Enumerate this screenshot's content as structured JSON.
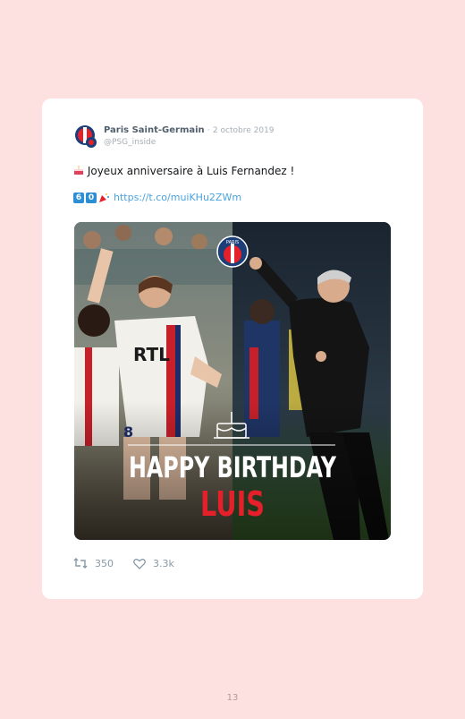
{
  "tweet": {
    "display_name": "Paris Saint-Germain",
    "separator": "·",
    "date": "2 octobre 2019",
    "handle": "@PSG_inside",
    "line1": "Joyeux anniversaire à Luis Fernandez !",
    "badge_digits": [
      "6",
      "0"
    ],
    "link": "https://t.co/muiKHu2ZWm",
    "retweets": "350",
    "likes": "3.3k"
  },
  "media": {
    "jersey_text": "RTL",
    "shorts_number": "8",
    "banner_line1": "HAPPY BIRTHDAY",
    "banner_line2": "LUIS",
    "crest_text": "PARIS"
  },
  "icons": {
    "avatar": "psg-avatar-icon",
    "cake": "cake-icon",
    "party": "party-popper-icon",
    "retweet": "retweet-icon",
    "like": "heart-icon"
  },
  "colors": {
    "page_bg": "#fde0e0",
    "card_bg": "#ffffff",
    "link": "#4aa3df",
    "badge": "#2b8fd6",
    "banner_red": "#e5202a"
  },
  "page_number": "13"
}
